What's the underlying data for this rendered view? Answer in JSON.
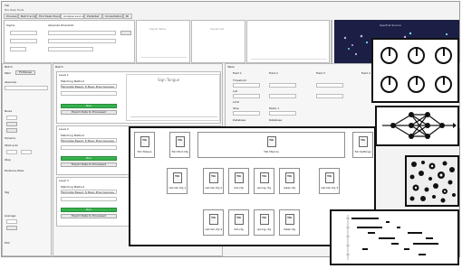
{
  "main_window": {
    "title": "Tiki",
    "menu": "File  Help  Tools",
    "toolbar_tabs": [
      "Process",
      "Batch script",
      "Find Peak Preview",
      "Analyse source",
      "Prefs/Set",
      "Consultation",
      "Bl"
    ],
    "active_tab_index": 3,
    "toolbar_labels": [
      "Sigma",
      "Absolute threshold"
    ],
    "plot_labels": [
      "Signal Table",
      "Signal Set",
      "Spectral Source"
    ]
  },
  "left_panel": {
    "title": "Batch",
    "rows": [
      "Mkm",
      "Ft-Mouse",
      "Absolute",
      "Noise",
      "Scheme",
      "Start-scan",
      "Stop",
      "Distance-Wise",
      "Tag",
      "Average",
      "Plot"
    ]
  },
  "mid_panel": {
    "title": "Batch",
    "sections": [
      {
        "head": "Level 1",
        "field1": "Matching Method",
        "dropdown": "Template Based, 8 Mean  Pixel Average",
        "run": "Run",
        "export": "Export Data to Processed"
      },
      {
        "head": "Level 2",
        "field1": "Matching Method",
        "dropdown": "Template Based, 8 Mean  Pixel Average",
        "run": "Run",
        "export": "Export Data to Processed"
      },
      {
        "head": "Level 3",
        "field1": "Matching Method",
        "dropdown": "Template Based, 8 Mean  Pixel Average",
        "run": "Run",
        "export": "Export Data to Processed"
      }
    ],
    "chart_title": "Sign Tongue"
  },
  "right_table": {
    "title": "Table",
    "cols": [
      "Field 1",
      "Field 2",
      "Field 3",
      "Field 4"
    ],
    "row_labels": [
      "Threshold",
      "List",
      "Limit",
      "Stop",
      "Mode 1",
      "Database",
      "Database"
    ]
  },
  "files": {
    "top_row": [
      {
        "name": "Tiki Tokens"
      },
      {
        "name": "Tiki Mod Cfg"
      },
      {
        "name": "Tiki Macros"
      },
      {
        "name": "Tiki Settings"
      }
    ],
    "mid_row": [
      {
        "name": "cell-list-cfg 1"
      },
      {
        "name": "cell-list-cfg 2"
      },
      {
        "name": "list-cfg"
      },
      {
        "name": "spring-cfg"
      },
      {
        "name": "label-cfg"
      },
      {
        "name": "cell-list-cfg 3"
      }
    ],
    "bottom_row": [
      {
        "name": "cell-list-cfg 4"
      },
      {
        "name": "list-cfg"
      },
      {
        "name": "spring-cfg"
      },
      {
        "name": "label-cfg"
      }
    ]
  },
  "icons": {
    "dials": "dial-grid-icon",
    "network": "neural-network-icon",
    "blobs": "cell-blobs-icon",
    "raster": "spike-raster-icon"
  },
  "colors": {
    "run_green": "#37b24d",
    "border_dark": "#111111",
    "spectral_bg": "#1b1f45"
  }
}
